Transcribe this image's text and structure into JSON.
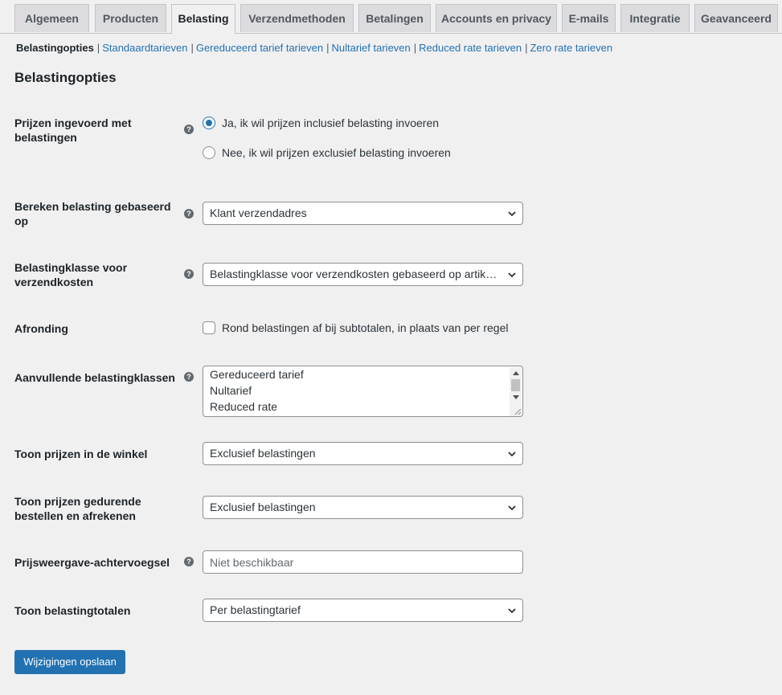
{
  "tabs": [
    {
      "label": "Algemeen",
      "active": false
    },
    {
      "label": "Producten",
      "active": false
    },
    {
      "label": "Belasting",
      "active": true
    },
    {
      "label": "Verzendmethoden",
      "active": false
    },
    {
      "label": "Betalingen",
      "active": false
    },
    {
      "label": "Accounts en privacy",
      "active": false
    },
    {
      "label": "E-mails",
      "active": false
    },
    {
      "label": "Integratie",
      "active": false
    },
    {
      "label": "Geavanceerd",
      "active": false
    }
  ],
  "subnav": {
    "current": "Belastingopties",
    "links": [
      "Standaardtarieven",
      "Gereduceerd tarief tarieven",
      "Nultarief tarieven",
      "Reduced rate tarieven",
      "Zero rate tarieven"
    ],
    "separator": "|"
  },
  "section_title": "Belastingopties",
  "help_icon_glyph": "?",
  "fields": {
    "prices_entered": {
      "label": "Prijzen ingevoerd met belastingen",
      "options": [
        {
          "label": "Ja, ik wil prijzen inclusief belasting invoeren",
          "selected": true
        },
        {
          "label": "Nee, ik wil prijzen exclusief belasting invoeren",
          "selected": false
        }
      ]
    },
    "calc_based_on": {
      "label": "Bereken belasting gebaseerd op",
      "value": "Klant verzendadres"
    },
    "shipping_tax_class": {
      "label": "Belastingklasse voor verzendkosten",
      "value": "Belastingklasse voor verzendkosten gebaseerd op artikel…"
    },
    "rounding": {
      "label": "Afronding",
      "checkbox_label": "Rond belastingen af bij subtotalen, in plaats van per regel",
      "checked": false
    },
    "additional_classes": {
      "label": "Aanvullende belastingklassen",
      "lines": [
        "Gereduceerd tarief",
        "Nultarief",
        "Reduced rate"
      ]
    },
    "display_shop": {
      "label": "Toon prijzen in de winkel",
      "value": "Exclusief belastingen"
    },
    "display_cart": {
      "label": "Toon prijzen gedurende bestellen en afrekenen",
      "value": "Exclusief belastingen"
    },
    "price_suffix": {
      "label": "Prijsweergave-achtervoegsel",
      "value": "",
      "placeholder": "Niet beschikbaar"
    },
    "tax_totals": {
      "label": "Toon belastingtotalen",
      "value": "Per belastingtarief"
    }
  },
  "save_button": "Wijzigingen opslaan",
  "colors": {
    "accent": "#2271b1",
    "background": "#f0f0f1",
    "tab_inactive": "#dcdcde",
    "border": "#c3c4c7"
  }
}
